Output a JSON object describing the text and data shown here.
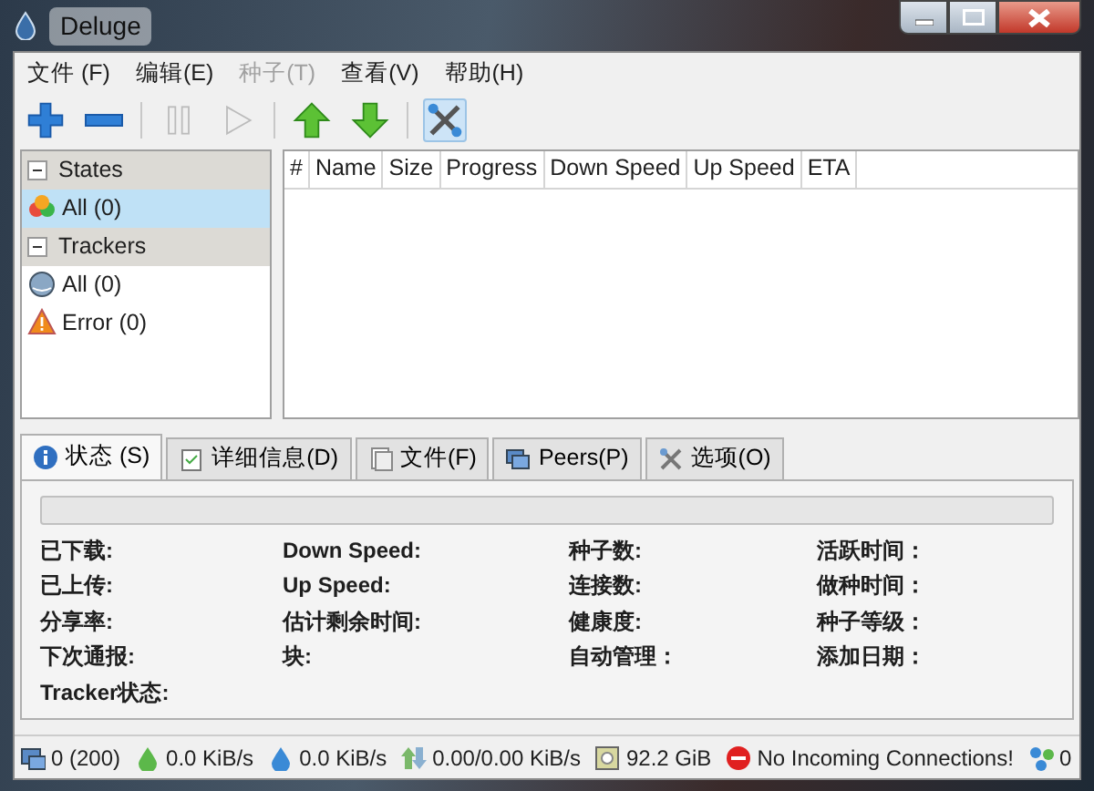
{
  "window": {
    "title": "Deluge"
  },
  "menu": [
    {
      "label": "文件 (F)",
      "disabled": false
    },
    {
      "label": "编辑(E)",
      "disabled": false
    },
    {
      "label": "种子(T)",
      "disabled": true
    },
    {
      "label": "查看(V)",
      "disabled": false
    },
    {
      "label": "帮助(H)",
      "disabled": false
    }
  ],
  "toolbar": [
    {
      "kind": "add",
      "disabled": false
    },
    {
      "kind": "remove",
      "disabled": false
    },
    {
      "kind": "sep"
    },
    {
      "kind": "pause",
      "disabled": true
    },
    {
      "kind": "resume",
      "disabled": true
    },
    {
      "kind": "sep"
    },
    {
      "kind": "up",
      "disabled": false
    },
    {
      "kind": "down",
      "disabled": false
    },
    {
      "kind": "sep"
    },
    {
      "kind": "prefs",
      "disabled": false
    }
  ],
  "sidebar": [
    {
      "label": "States",
      "expanded": true,
      "children": [
        {
          "label": "All (0)",
          "selected": true
        }
      ]
    },
    {
      "label": "Trackers",
      "expanded": true,
      "children": [
        {
          "label": "All (0)",
          "selected": false
        },
        {
          "label": "Error (0)",
          "selected": false
        }
      ]
    }
  ],
  "table": {
    "columns": [
      "#",
      "Name",
      "Size",
      "Progress",
      "Down Speed",
      "Up Speed",
      "ETA"
    ]
  },
  "tabs": [
    {
      "label": "状态 (S)",
      "selected": true
    },
    {
      "label": "详细信息(D)",
      "selected": false
    },
    {
      "label": "文件(F)",
      "selected": false
    },
    {
      "label": "Peers(P)",
      "selected": false
    },
    {
      "label": "选项(O)",
      "selected": false
    }
  ],
  "status": {
    "progress": {
      "level": 0
    },
    "columns": [
      [
        "已下载:",
        "已上传:",
        "分享率:",
        "下次通报:",
        "Tracker状态:"
      ],
      [
        "Down Speed:",
        "Up Speed:",
        "估计剩余时间:",
        "块:"
      ],
      [
        "种子数:",
        "连接数:",
        "健康度:",
        "自动管理："
      ],
      [
        "活跃时间：",
        "做种时间：",
        "种子等级：",
        "添加日期："
      ]
    ]
  },
  "status_bar": [
    "0 (200)",
    "0.0 KiB/s",
    "0.0 KiB/s",
    "0.00/0.00 KiB/s",
    "92.2 GiB",
    "No Incoming Connections!",
    "0"
  ]
}
